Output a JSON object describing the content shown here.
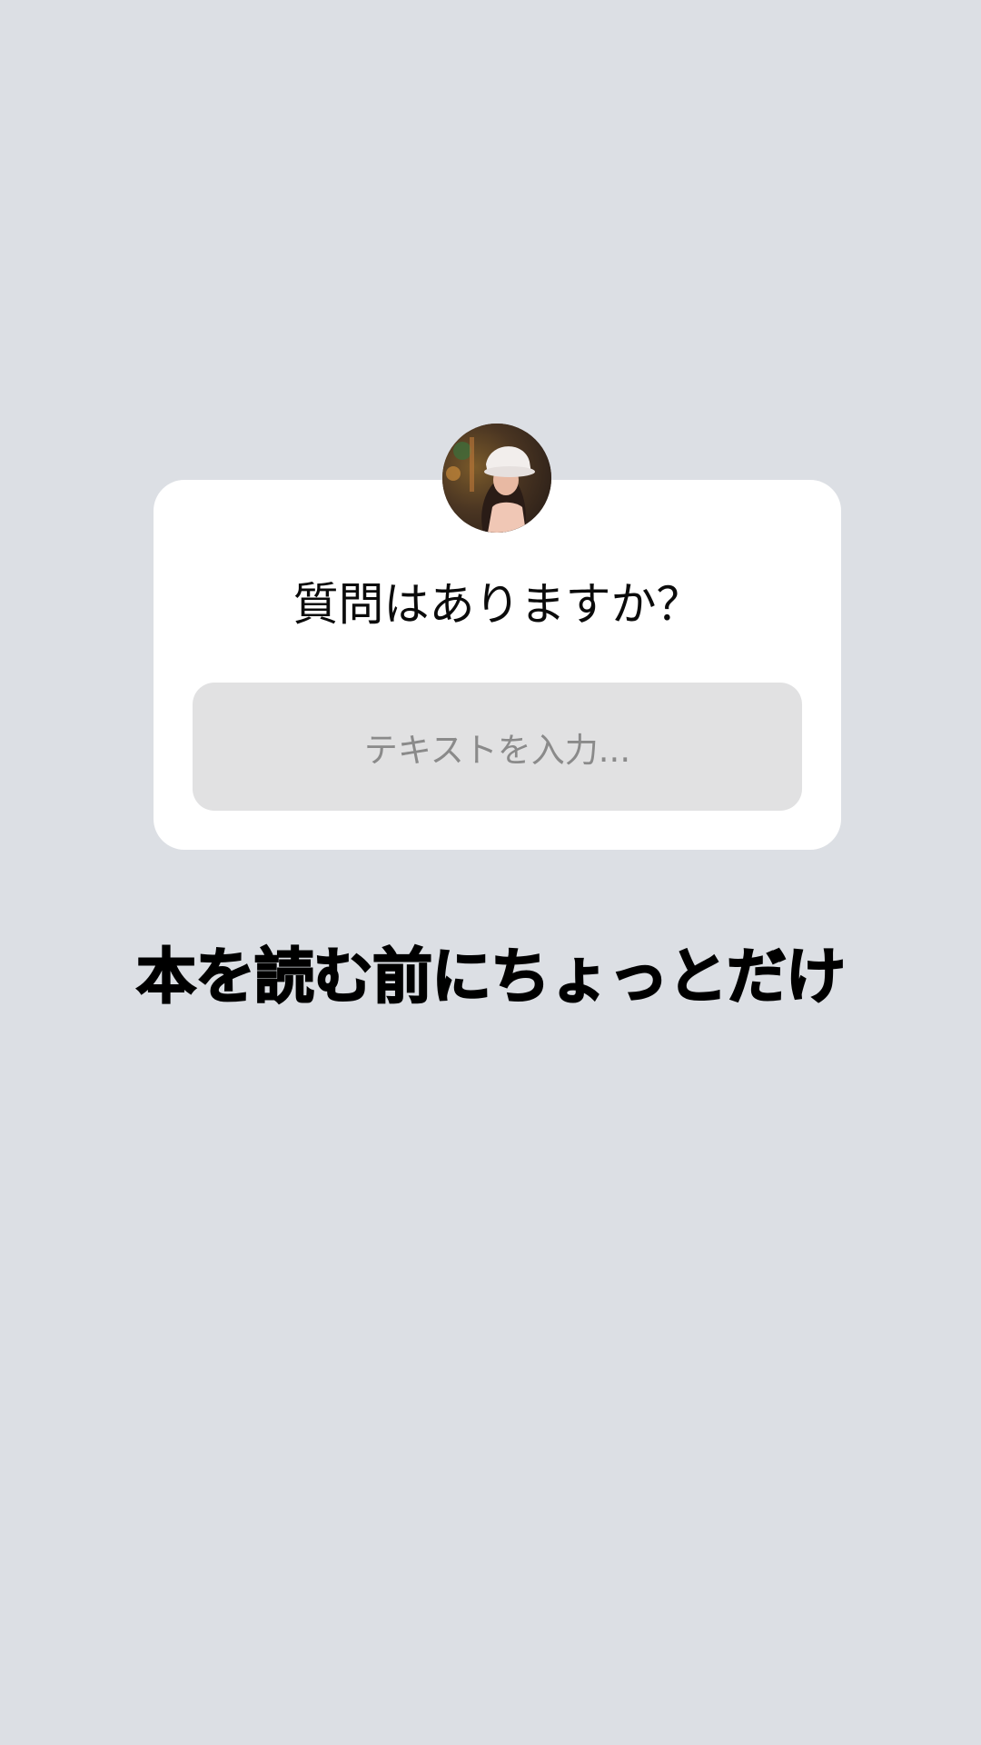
{
  "question_sticker": {
    "question": "質問はありますか？",
    "input_placeholder": "テキストを入力..."
  },
  "caption": {
    "text": "本を読む前にちょっとだけ"
  },
  "colors": {
    "background": "#dcdfe4",
    "card": "#ffffff",
    "input_background": "#e1e1e2",
    "placeholder_text": "#8a8a8a",
    "caption_text": "#000000"
  },
  "icons": {
    "avatar": "profile-photo-avatar"
  }
}
